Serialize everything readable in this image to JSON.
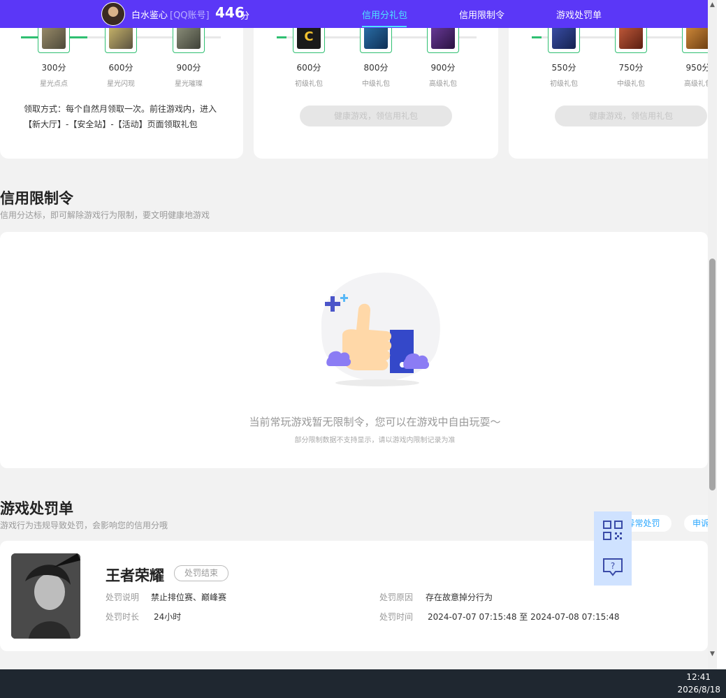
{
  "header": {
    "username": "白水鉴心",
    "account_type": "[QQ账号]",
    "score": "446",
    "score_unit": "分",
    "tabs": [
      {
        "label": "信用分礼包",
        "active": true
      },
      {
        "label": "信用限制令",
        "active": false
      },
      {
        "label": "游戏处罚单",
        "active": false
      }
    ]
  },
  "gift_cards": [
    {
      "rewards": [
        {
          "points": "300分",
          "name": "星光点点"
        },
        {
          "points": "600分",
          "name": "星光闪现"
        },
        {
          "points": "900分",
          "name": "星光璀璨"
        }
      ],
      "claim_text": "领取方式：每个自然月领取一次。前往游戏内，进入【新大厅】-【安全站】-【活动】页面领取礼包"
    },
    {
      "rewards": [
        {
          "points": "600分",
          "name": "初级礼包"
        },
        {
          "points": "800分",
          "name": "中级礼包"
        },
        {
          "points": "900分",
          "name": "高级礼包"
        }
      ],
      "button_label": "健康游戏，领信用礼包"
    },
    {
      "rewards": [
        {
          "points": "550分",
          "name": "初级礼包"
        },
        {
          "points": "750分",
          "name": "中级礼包"
        },
        {
          "points": "950分",
          "name": "高级礼包"
        }
      ],
      "button_label": "健康游戏，领信用礼包"
    }
  ],
  "restriction": {
    "title": "信用限制令",
    "subtitle": "信用分达标，即可解除游戏行为限制，要文明健康地游戏",
    "empty_title": "当前常玩游戏暂无限制令，您可以在游戏中自由玩耍～",
    "empty_note": "部分限制数据不支持显示，请以游戏内限制记录为准"
  },
  "penalty": {
    "title": "游戏处罚单",
    "subtitle": "游戏行为违规导致处罚，会影响您的信用分哦",
    "pill_labels": [
      "异常处罚",
      "申诉"
    ],
    "record": {
      "game_name": "王者荣耀",
      "status": "处罚结束",
      "desc_label": "处罚说明",
      "desc_value": "禁止排位赛、巅峰赛",
      "duration_label": "处罚时长",
      "duration_value": "24小时",
      "reason_label": "处罚原因",
      "reason_value": "存在故意掉分行为",
      "time_label": "处罚时间",
      "time_value": "2024-07-07 07:15:48 至 2024-07-08 07:15:48"
    }
  },
  "taskbar": {
    "time": "12:41",
    "date": "2026/8/18"
  },
  "colors": {
    "header_bg": "#5b37f7",
    "active_tab": "#4fe3ff",
    "progress": "#2fbf71",
    "link": "#2aa7ff"
  }
}
